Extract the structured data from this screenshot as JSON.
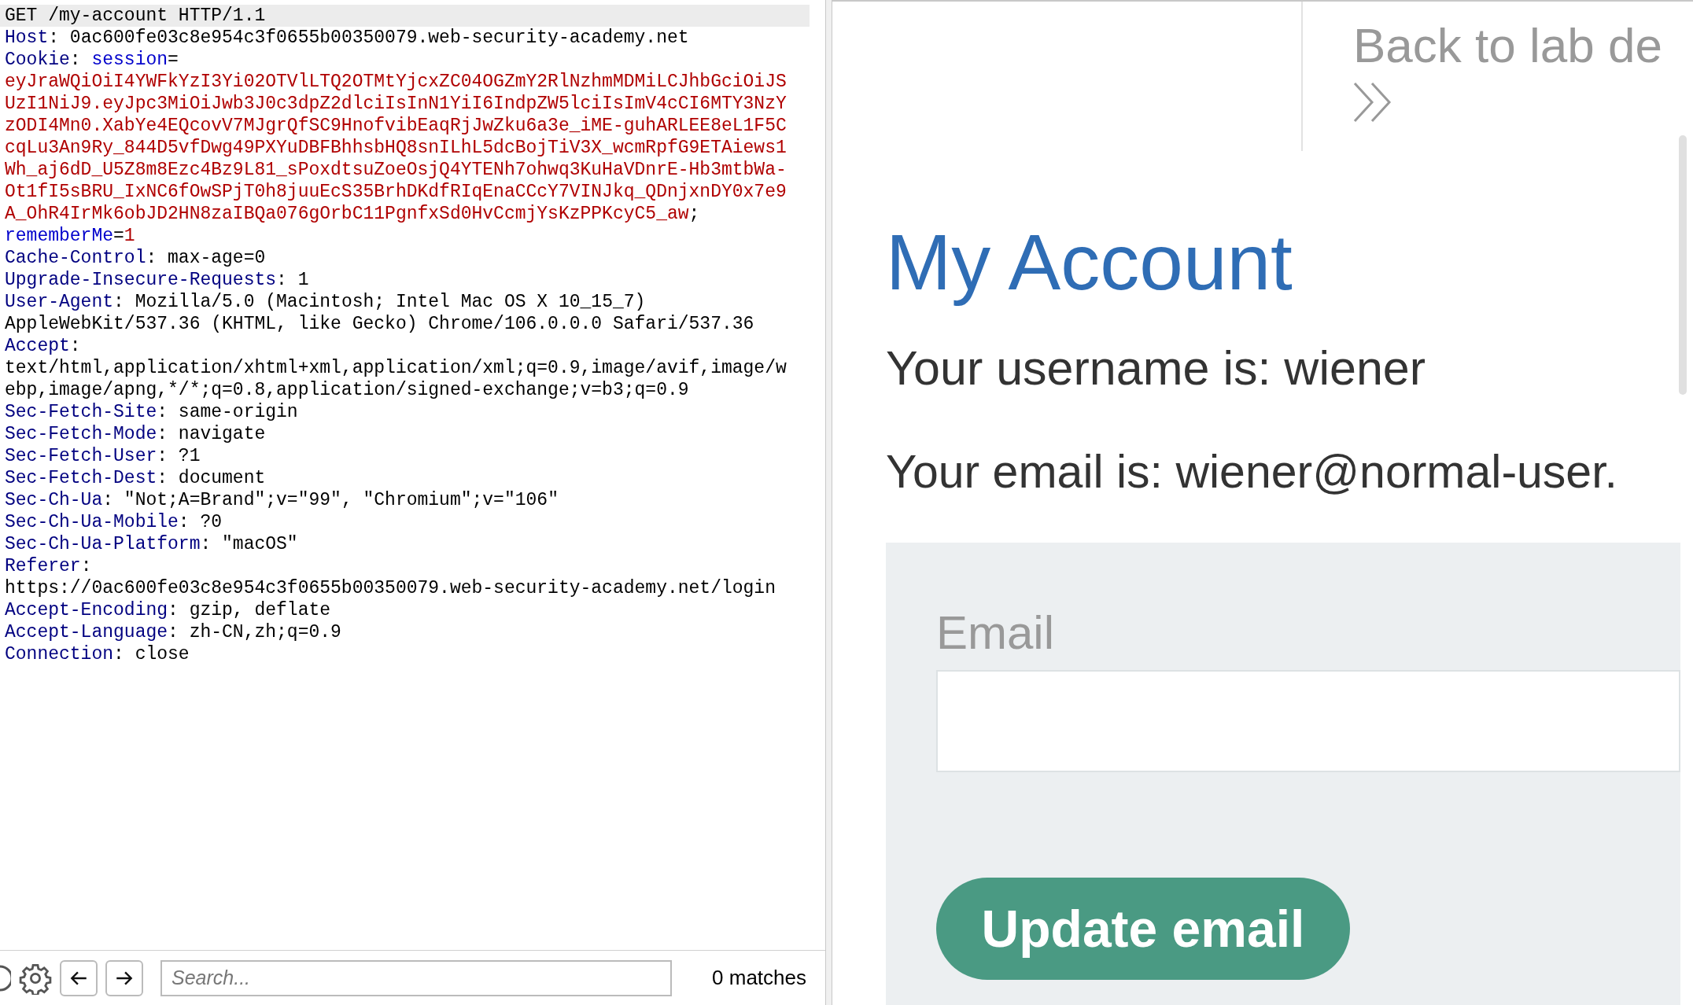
{
  "request_lines": [
    {
      "highlighted": true,
      "segments": [
        {
          "kind": "plain",
          "text": "GET /my-account HTTP/1.1"
        }
      ]
    },
    {
      "highlighted": false,
      "segments": [
        {
          "kind": "header-name",
          "text": "Host"
        },
        {
          "kind": "plain",
          "text": ": 0ac600fe03c8e954c3f0655b00350079.web-security-academy.net"
        }
      ]
    },
    {
      "highlighted": false,
      "segments": [
        {
          "kind": "header-name",
          "text": "Cookie"
        },
        {
          "kind": "plain",
          "text": ": "
        },
        {
          "kind": "cookie-name",
          "text": "session"
        },
        {
          "kind": "plain",
          "text": "="
        }
      ]
    },
    {
      "highlighted": false,
      "segments": [
        {
          "kind": "cookie-value",
          "text": "eyJraWQiOiI4YWFkYzI3Yi02OTVlLTQ2OTMtYjcxZC04OGZmY2RlNzhmMDMiLCJhbGciOiJS"
        }
      ]
    },
    {
      "highlighted": false,
      "segments": [
        {
          "kind": "cookie-value",
          "text": "UzI1NiJ9.eyJpc3MiOiJwb3J0c3dpZ2dlciIsInN1YiI6IndpZW5lciIsImV4cCI6MTY3NzY"
        }
      ]
    },
    {
      "highlighted": false,
      "segments": [
        {
          "kind": "cookie-value",
          "text": "zODI4Mn0.XabYe4EQcovV7MJgrQfSC9HnofvibEaqRjJwZku6a3e_iME-guhARLEE8eL1F5C"
        }
      ]
    },
    {
      "highlighted": false,
      "segments": [
        {
          "kind": "cookie-value",
          "text": "cqLu3An9Ry_844D5vfDwg49PXYuDBFBhhsbHQ8snILhL5dcBojTiV3X_wcmRpfG9ETAiews1"
        }
      ]
    },
    {
      "highlighted": false,
      "segments": [
        {
          "kind": "cookie-value",
          "text": "Wh_aj6dD_U5Z8m8Ezc4Bz9L81_sPoxdtsuZoeOsjQ4YTENh7ohwq3KuHaVDnrE-Hb3mtbWa-"
        }
      ]
    },
    {
      "highlighted": false,
      "segments": [
        {
          "kind": "cookie-value",
          "text": "Ot1fI5sBRU_IxNC6fOwSPjT0h8juuEcS35BrhDKdfRIqEnaCCcY7VINJkq_QDnjxnDY0x7e9"
        }
      ]
    },
    {
      "highlighted": false,
      "segments": [
        {
          "kind": "cookie-value",
          "text": "A_OhR4IrMk6obJD2HN8zaIBQa076gOrbC11PgnfxSd0HvCcmjYsKzPPKcyC5_aw"
        },
        {
          "kind": "plain",
          "text": ";"
        }
      ]
    },
    {
      "highlighted": false,
      "segments": [
        {
          "kind": "cookie-name",
          "text": "rememberMe"
        },
        {
          "kind": "plain",
          "text": "="
        },
        {
          "kind": "cookie-value",
          "text": "1"
        }
      ]
    },
    {
      "highlighted": false,
      "segments": [
        {
          "kind": "header-name",
          "text": "Cache-Control"
        },
        {
          "kind": "plain",
          "text": ": max-age=0"
        }
      ]
    },
    {
      "highlighted": false,
      "segments": [
        {
          "kind": "header-name",
          "text": "Upgrade-Insecure-Requests"
        },
        {
          "kind": "plain",
          "text": ": 1"
        }
      ]
    },
    {
      "highlighted": false,
      "segments": [
        {
          "kind": "header-name",
          "text": "User-Agent"
        },
        {
          "kind": "plain",
          "text": ": Mozilla/5.0 (Macintosh; Intel Mac OS X 10_15_7)"
        }
      ]
    },
    {
      "highlighted": false,
      "segments": [
        {
          "kind": "plain",
          "text": "AppleWebKit/537.36 (KHTML, like Gecko) Chrome/106.0.0.0 Safari/537.36"
        }
      ]
    },
    {
      "highlighted": false,
      "segments": [
        {
          "kind": "header-name",
          "text": "Accept"
        },
        {
          "kind": "plain",
          "text": ":"
        }
      ]
    },
    {
      "highlighted": false,
      "segments": [
        {
          "kind": "plain",
          "text": "text/html,application/xhtml+xml,application/xml;q=0.9,image/avif,image/w"
        }
      ]
    },
    {
      "highlighted": false,
      "segments": [
        {
          "kind": "plain",
          "text": "ebp,image/apng,*/*;q=0.8,application/signed-exchange;v=b3;q=0.9"
        }
      ]
    },
    {
      "highlighted": false,
      "segments": [
        {
          "kind": "header-name",
          "text": "Sec-Fetch-Site"
        },
        {
          "kind": "plain",
          "text": ": same-origin"
        }
      ]
    },
    {
      "highlighted": false,
      "segments": [
        {
          "kind": "header-name",
          "text": "Sec-Fetch-Mode"
        },
        {
          "kind": "plain",
          "text": ": navigate"
        }
      ]
    },
    {
      "highlighted": false,
      "segments": [
        {
          "kind": "header-name",
          "text": "Sec-Fetch-User"
        },
        {
          "kind": "plain",
          "text": ": ?1"
        }
      ]
    },
    {
      "highlighted": false,
      "segments": [
        {
          "kind": "header-name",
          "text": "Sec-Fetch-Dest"
        },
        {
          "kind": "plain",
          "text": ": document"
        }
      ]
    },
    {
      "highlighted": false,
      "segments": [
        {
          "kind": "header-name",
          "text": "Sec-Ch-Ua"
        },
        {
          "kind": "plain",
          "text": ": \"Not;A=Brand\";v=\"99\", \"Chromium\";v=\"106\""
        }
      ]
    },
    {
      "highlighted": false,
      "segments": [
        {
          "kind": "header-name",
          "text": "Sec-Ch-Ua-Mobile"
        },
        {
          "kind": "plain",
          "text": ": ?0"
        }
      ]
    },
    {
      "highlighted": false,
      "segments": [
        {
          "kind": "header-name",
          "text": "Sec-Ch-Ua-Platform"
        },
        {
          "kind": "plain",
          "text": ": \"macOS\""
        }
      ]
    },
    {
      "highlighted": false,
      "segments": [
        {
          "kind": "header-name",
          "text": "Referer"
        },
        {
          "kind": "plain",
          "text": ":"
        }
      ]
    },
    {
      "highlighted": false,
      "segments": [
        {
          "kind": "plain",
          "text": "https://0ac600fe03c8e954c3f0655b00350079.web-security-academy.net/login"
        }
      ]
    },
    {
      "highlighted": false,
      "segments": [
        {
          "kind": "header-name",
          "text": "Accept-Encoding"
        },
        {
          "kind": "plain",
          "text": ": gzip, deflate"
        }
      ]
    },
    {
      "highlighted": false,
      "segments": [
        {
          "kind": "header-name",
          "text": "Accept-Language"
        },
        {
          "kind": "plain",
          "text": ": zh-CN,zh;q=0.9"
        }
      ]
    },
    {
      "highlighted": false,
      "segments": [
        {
          "kind": "header-name",
          "text": "Connection"
        },
        {
          "kind": "plain",
          "text": ": close"
        }
      ]
    }
  ],
  "search_bar": {
    "placeholder": "Search...",
    "matches": "0 matches"
  },
  "browser_view": {
    "back_link": "Back to lab de",
    "heading": "My Account",
    "username_line": "Your username is: wiener",
    "email_line": "Your email is: wiener@normal-user.",
    "form": {
      "email_label": "Email",
      "button": "Update email"
    }
  }
}
